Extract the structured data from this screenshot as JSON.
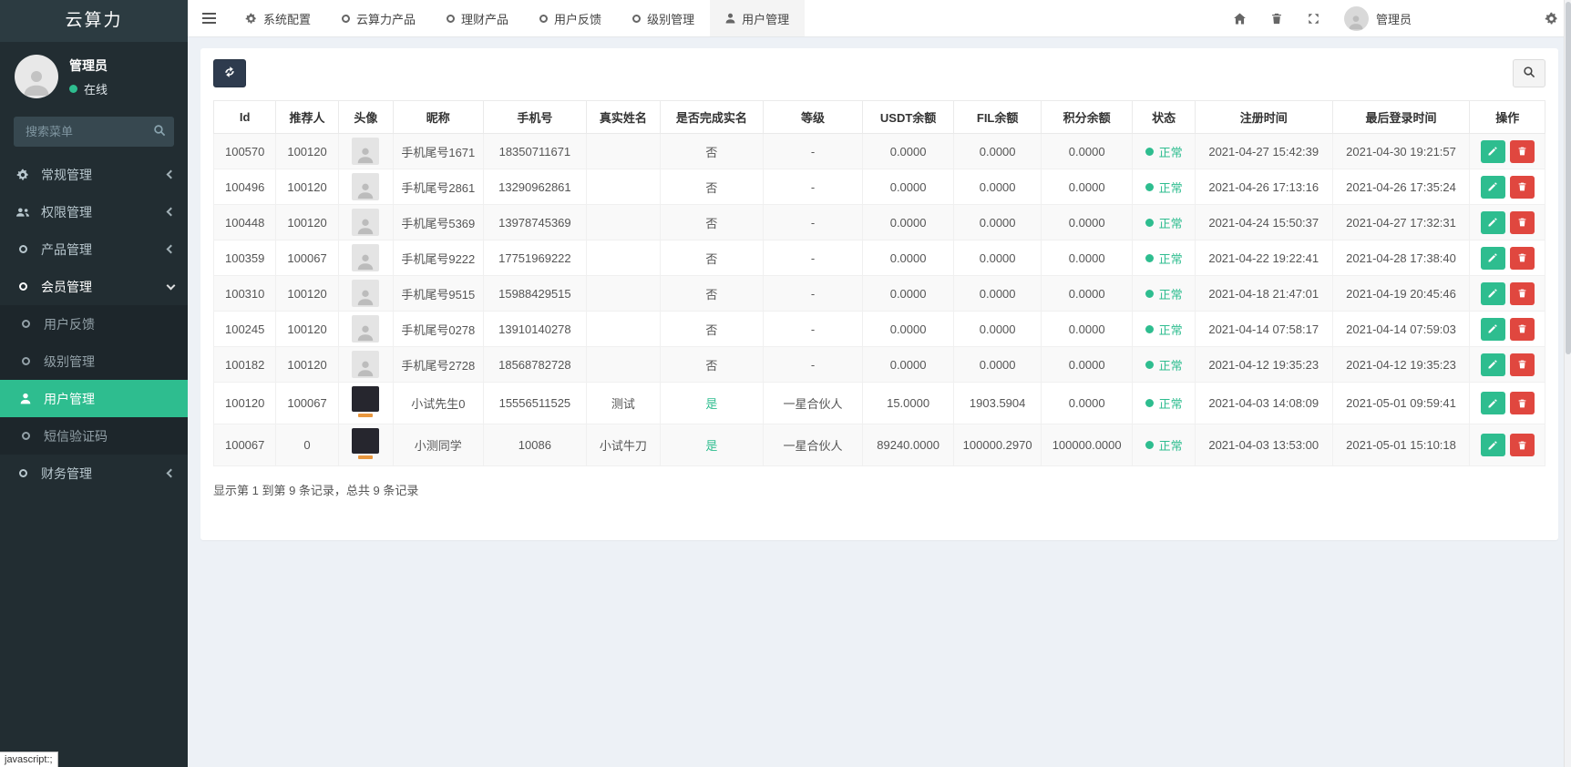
{
  "app": {
    "title": "云算力",
    "status_bar": "javascript:;"
  },
  "colors": {
    "accent_green": "#2ebd8f",
    "danger_red": "#e0473f",
    "sidebar_bg": "#222d32",
    "navbar_bg": "#ffffff",
    "content_bg": "#edf1f6",
    "refresh_btn_bg": "#2e3b4e"
  },
  "sidebar": {
    "user": {
      "name": "管理员",
      "status": "在线"
    },
    "search_placeholder": "搜索菜单",
    "items": [
      {
        "label": "常规管理",
        "icon": "gears-icon",
        "chevron": "left"
      },
      {
        "label": "权限管理",
        "icon": "users-icon",
        "chevron": "left"
      },
      {
        "label": "产品管理",
        "icon": "circle-icon",
        "chevron": "left"
      },
      {
        "label": "会员管理",
        "icon": "circle-icon",
        "chevron": "down",
        "expanded": true,
        "children": [
          {
            "label": "用户反馈",
            "icon": "circle-icon"
          },
          {
            "label": "级别管理",
            "icon": "circle-icon"
          },
          {
            "label": "用户管理",
            "icon": "user-icon",
            "active": true
          },
          {
            "label": "短信验证码",
            "icon": "circle-icon"
          }
        ]
      },
      {
        "label": "财务管理",
        "icon": "circle-icon",
        "chevron": "left"
      }
    ]
  },
  "navbar": {
    "tabs": [
      {
        "label": "系统配置",
        "icon": "gear-icon"
      },
      {
        "label": "云算力产品",
        "icon": "circle-icon"
      },
      {
        "label": "理财产品",
        "icon": "circle-icon"
      },
      {
        "label": "用户反馈",
        "icon": "circle-icon"
      },
      {
        "label": "级别管理",
        "icon": "circle-icon"
      },
      {
        "label": "用户管理",
        "icon": "user-icon",
        "active": true
      }
    ],
    "right": {
      "user_label": "管理员"
    }
  },
  "table": {
    "headers": [
      "Id",
      "推荐人",
      "头像",
      "昵称",
      "手机号",
      "真实姓名",
      "是否完成实名",
      "等级",
      "USDT余额",
      "FIL余额",
      "积分余额",
      "状态",
      "注册时间",
      "最后登录时间",
      "操作"
    ],
    "verified_yes": "是",
    "rows": [
      {
        "id": "100570",
        "referrer": "100120",
        "avatar": "placeholder",
        "nickname": "手机尾号1671",
        "phone": "18350711671",
        "real_name": "",
        "verified": "否",
        "level": "-",
        "usdt": "0.0000",
        "fil": "0.0000",
        "points": "0.0000",
        "status": "正常",
        "registered": "2021-04-27 15:42:39",
        "last_login": "2021-04-30 19:21:57"
      },
      {
        "id": "100496",
        "referrer": "100120",
        "avatar": "placeholder",
        "nickname": "手机尾号2861",
        "phone": "13290962861",
        "real_name": "",
        "verified": "否",
        "level": "-",
        "usdt": "0.0000",
        "fil": "0.0000",
        "points": "0.0000",
        "status": "正常",
        "registered": "2021-04-26 17:13:16",
        "last_login": "2021-04-26 17:35:24"
      },
      {
        "id": "100448",
        "referrer": "100120",
        "avatar": "placeholder",
        "nickname": "手机尾号5369",
        "phone": "13978745369",
        "real_name": "",
        "verified": "否",
        "level": "-",
        "usdt": "0.0000",
        "fil": "0.0000",
        "points": "0.0000",
        "status": "正常",
        "registered": "2021-04-24 15:50:37",
        "last_login": "2021-04-27 17:32:31"
      },
      {
        "id": "100359",
        "referrer": "100067",
        "avatar": "placeholder",
        "nickname": "手机尾号9222",
        "phone": "17751969222",
        "real_name": "",
        "verified": "否",
        "level": "-",
        "usdt": "0.0000",
        "fil": "0.0000",
        "points": "0.0000",
        "status": "正常",
        "registered": "2021-04-22 19:22:41",
        "last_login": "2021-04-28 17:38:40"
      },
      {
        "id": "100310",
        "referrer": "100120",
        "avatar": "placeholder",
        "nickname": "手机尾号9515",
        "phone": "15988429515",
        "real_name": "",
        "verified": "否",
        "level": "-",
        "usdt": "0.0000",
        "fil": "0.0000",
        "points": "0.0000",
        "status": "正常",
        "registered": "2021-04-18 21:47:01",
        "last_login": "2021-04-19 20:45:46"
      },
      {
        "id": "100245",
        "referrer": "100120",
        "avatar": "placeholder",
        "nickname": "手机尾号0278",
        "phone": "13910140278",
        "real_name": "",
        "verified": "否",
        "level": "-",
        "usdt": "0.0000",
        "fil": "0.0000",
        "points": "0.0000",
        "status": "正常",
        "registered": "2021-04-14 07:58:17",
        "last_login": "2021-04-14 07:59:03"
      },
      {
        "id": "100182",
        "referrer": "100120",
        "avatar": "placeholder",
        "nickname": "手机尾号2728",
        "phone": "18568782728",
        "real_name": "",
        "verified": "否",
        "level": "-",
        "usdt": "0.0000",
        "fil": "0.0000",
        "points": "0.0000",
        "status": "正常",
        "registered": "2021-04-12 19:35:23",
        "last_login": "2021-04-12 19:35:23"
      },
      {
        "id": "100120",
        "referrer": "100067",
        "avatar": "photo",
        "nickname": "小试先生0",
        "phone": "15556511525",
        "real_name": "测试",
        "verified": "是",
        "level": "一星合伙人",
        "usdt": "15.0000",
        "fil": "1903.5904",
        "points": "0.0000",
        "status": "正常",
        "registered": "2021-04-03 14:08:09",
        "last_login": "2021-05-01 09:59:41"
      },
      {
        "id": "100067",
        "referrer": "0",
        "avatar": "photo",
        "nickname": "小测同学",
        "phone": "10086",
        "real_name": "小试牛刀",
        "verified": "是",
        "level": "一星合伙人",
        "usdt": "89240.0000",
        "fil": "100000.2970",
        "points": "100000.0000",
        "status": "正常",
        "registered": "2021-04-03 13:53:00",
        "last_login": "2021-05-01 15:10:18"
      }
    ],
    "footer": "显示第 1 到第 9 条记录，总共 9 条记录"
  }
}
